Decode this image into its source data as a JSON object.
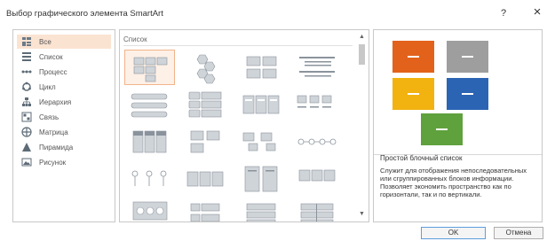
{
  "window": {
    "title": "Выбор графического элемента SmartArt",
    "help_label": "?",
    "close_label": "×"
  },
  "categories": [
    {
      "label": "Все",
      "icon": "all-icon",
      "selected": true
    },
    {
      "label": "Список",
      "icon": "list-icon"
    },
    {
      "label": "Процесс",
      "icon": "process-icon"
    },
    {
      "label": "Цикл",
      "icon": "cycle-icon"
    },
    {
      "label": "Иерархия",
      "icon": "hierarchy-icon"
    },
    {
      "label": "Связь",
      "icon": "relationship-icon"
    },
    {
      "label": "Матрица",
      "icon": "matrix-icon"
    },
    {
      "label": "Пирамида",
      "icon": "pyramid-icon"
    },
    {
      "label": "Рисунок",
      "icon": "picture-icon"
    }
  ],
  "gallery": {
    "header": "Список",
    "selected_index": 0,
    "tile_count": 20
  },
  "preview": {
    "title": "Простой блочный список",
    "description": "Служит для отображения непоследовательных или сгруппированных блоков информации. Позволяет экономить пространство как по горизонтали, так и по вертикали.",
    "colors": {
      "orange": "#e2621b",
      "gray": "#9e9e9e",
      "gold": "#f2b311",
      "blue": "#2c64b4",
      "green": "#5fa13d"
    }
  },
  "buttons": {
    "ok": "OK",
    "cancel": "Отмена"
  }
}
